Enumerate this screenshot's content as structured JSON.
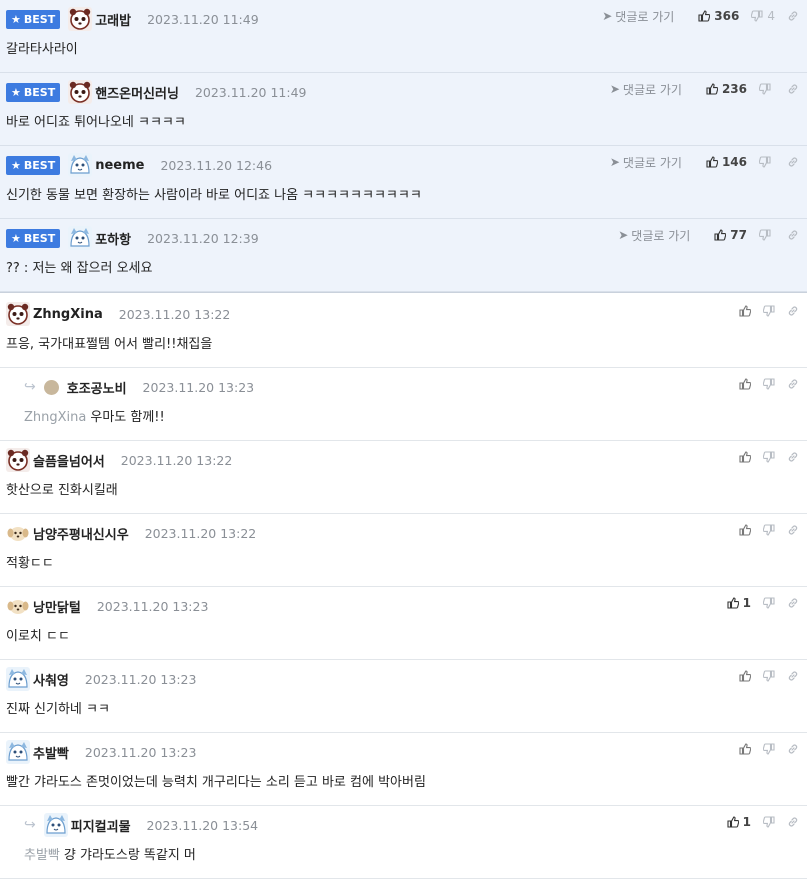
{
  "best_label": "BEST",
  "goto_label": "댓글로 가기",
  "colors": {
    "accent": "#3d7be0",
    "best_bg": "#eef3fb"
  },
  "best_comments": [
    {
      "nick": "고래밥",
      "date": "2023.11.20 11:49",
      "text": "갈라타사라이",
      "likes": "366",
      "dislikes": "4",
      "avatar": "panda-avatar"
    },
    {
      "nick": "핸즈온머신러닝",
      "date": "2023.11.20 11:49",
      "text": "바로 어디죠 튀어나오네 ㅋㅋㅋㅋ",
      "likes": "236",
      "dislikes": "",
      "avatar": "panda-avatar"
    },
    {
      "nick": "neeme",
      "date": "2023.11.20 12:46",
      "text": "신기한 동물 보면 환장하는 사람이라 바로 어디죠 나옴 ㅋㅋㅋㅋㅋㅋㅋㅋㅋㅋ",
      "likes": "146",
      "dislikes": "",
      "avatar": "blue-creature-avatar"
    },
    {
      "nick": "포하항",
      "date": "2023.11.20 12:39",
      "text": "?? : 저는 왜 잡으러 오세요",
      "likes": "77",
      "dislikes": "",
      "avatar": "blue-creature-avatar"
    }
  ],
  "comments": [
    {
      "nick": "ZhngXina",
      "date": "2023.11.20 13:22",
      "text": "프응, 국가대표쩔템 어서 빨리!!채집을",
      "likes": "",
      "avatar": "panda-avatar"
    },
    {
      "nick": "호조공노비",
      "date": "2023.11.20 13:23",
      "text": "우마도 함께!!",
      "reply_to": "ZhngXina",
      "likes": "",
      "avatar": "dot-avatar"
    },
    {
      "nick": "슬픔을넘어서",
      "date": "2023.11.20 13:22",
      "text": "핫산으로 진화시킬래",
      "likes": "",
      "avatar": "panda-avatar"
    },
    {
      "nick": "남양주평내신시우",
      "date": "2023.11.20 13:22",
      "text": "적황ㄷㄷ",
      "likes": "",
      "avatar": "puppy-avatar"
    },
    {
      "nick": "낭만닭털",
      "date": "2023.11.20 13:23",
      "text": "이로치 ㄷㄷ",
      "likes": "1",
      "avatar": "puppy-avatar"
    },
    {
      "nick": "사춰영",
      "date": "2023.11.20 13:23",
      "text": "진짜 신기하네 ㅋㅋ",
      "likes": "",
      "avatar": "blue-creature-avatar"
    },
    {
      "nick": "추발빡",
      "date": "2023.11.20 13:23",
      "text": "빨간 갸라도스 존멋이었는데 능력치 개구리다는 소리 듣고 바로 컴에 박아버림",
      "likes": "",
      "avatar": "blue-creature-avatar"
    },
    {
      "nick": "피지컬괴물",
      "date": "2023.11.20 13:54",
      "text": "걍 갸라도스랑 똑같지 머",
      "reply_to": "추발빡",
      "likes": "1",
      "avatar": "blue-creature-avatar"
    }
  ]
}
